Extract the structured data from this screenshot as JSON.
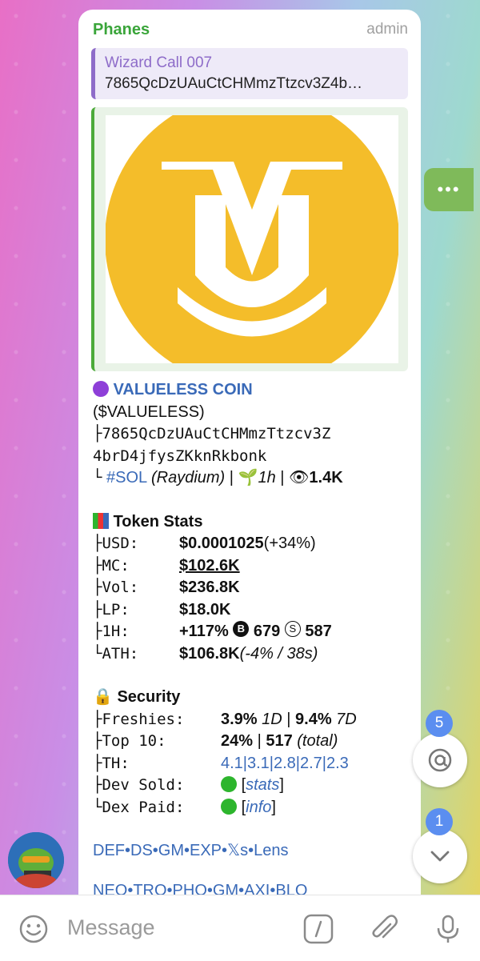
{
  "message": {
    "sender": "Phanes",
    "role": "admin",
    "reply": {
      "title": "Wizard Call 007",
      "text": "7865QcDzUAuCtCHMmzTtzcv3Z4b…"
    },
    "token": {
      "name": "VALUELESS COIN",
      "ticker": "($VALUELESS)",
      "address_line1": "├7865QcDzUAuCtCHMmzTtzcv3Z",
      "address_line2": "4brD4jfysZKknRkbonk",
      "chain_prefix": "└",
      "chain": "#SOL",
      "dex": "(Raydium)",
      "sep1": " | ",
      "age": "1h",
      "sep2": " | ",
      "views": "1.4K"
    },
    "stats": {
      "title": "Token Stats",
      "rows": [
        {
          "k": "├USD:",
          "v": "$0.0001025",
          "extra": " (+34%)"
        },
        {
          "k": "├MC:",
          "v": "$102.6K",
          "extra": ""
        },
        {
          "k": "├Vol:",
          "v": "$236.8K",
          "extra": ""
        },
        {
          "k": "├LP:",
          "v": "$18.0K",
          "extra": ""
        },
        {
          "k": "├1H:",
          "v": "+117%",
          "extra": ""
        },
        {
          "k": "└ATH:",
          "v": "$106.8K",
          "extra": " (-4% / 38s)"
        }
      ],
      "h1_buys": "679",
      "h1_sells": "587",
      "b_glyph": "B",
      "s_glyph": "S"
    },
    "security": {
      "title": "Security",
      "freshies_k": "├Freshies:",
      "freshies_1d": "3.9%",
      "freshies_1d_lbl": " 1D",
      "freshies_sep": " | ",
      "freshies_7d": "9.4%",
      "freshies_7d_lbl": " 7D",
      "top10_k": "├Top 10:",
      "top10_pct": "24%",
      "top10_sep": " | ",
      "top10_total": "517",
      "top10_total_lbl": " (total)",
      "th_k": "├TH:",
      "th_v": "4.1|3.1|2.8|2.7|2.3",
      "devsold_k": "├Dev Sold:",
      "devsold_link": "stats",
      "dexpaid_k": "└Dex Paid:",
      "dexpaid_link": "info",
      "lbr": "[",
      "rbr": "]"
    },
    "links1": "DEF•DS•GM•EXP•𝕏s•Lens",
    "links2": "NEO•TRO•PHO•GM•AXI•BLO"
  },
  "composer": {
    "placeholder": "Message"
  },
  "badges": {
    "mentions": "5",
    "unread": "1"
  },
  "colors": {
    "accent": "#3a6ab8",
    "sender": "#3aa53a",
    "logo_yellow": "#f4bd2a",
    "fab_badge": "#5b8ef0"
  },
  "icons": [
    "emoji-icon",
    "command-icon",
    "attach-icon",
    "mic-icon",
    "mention-icon",
    "chevron-down-icon",
    "more-icon"
  ]
}
